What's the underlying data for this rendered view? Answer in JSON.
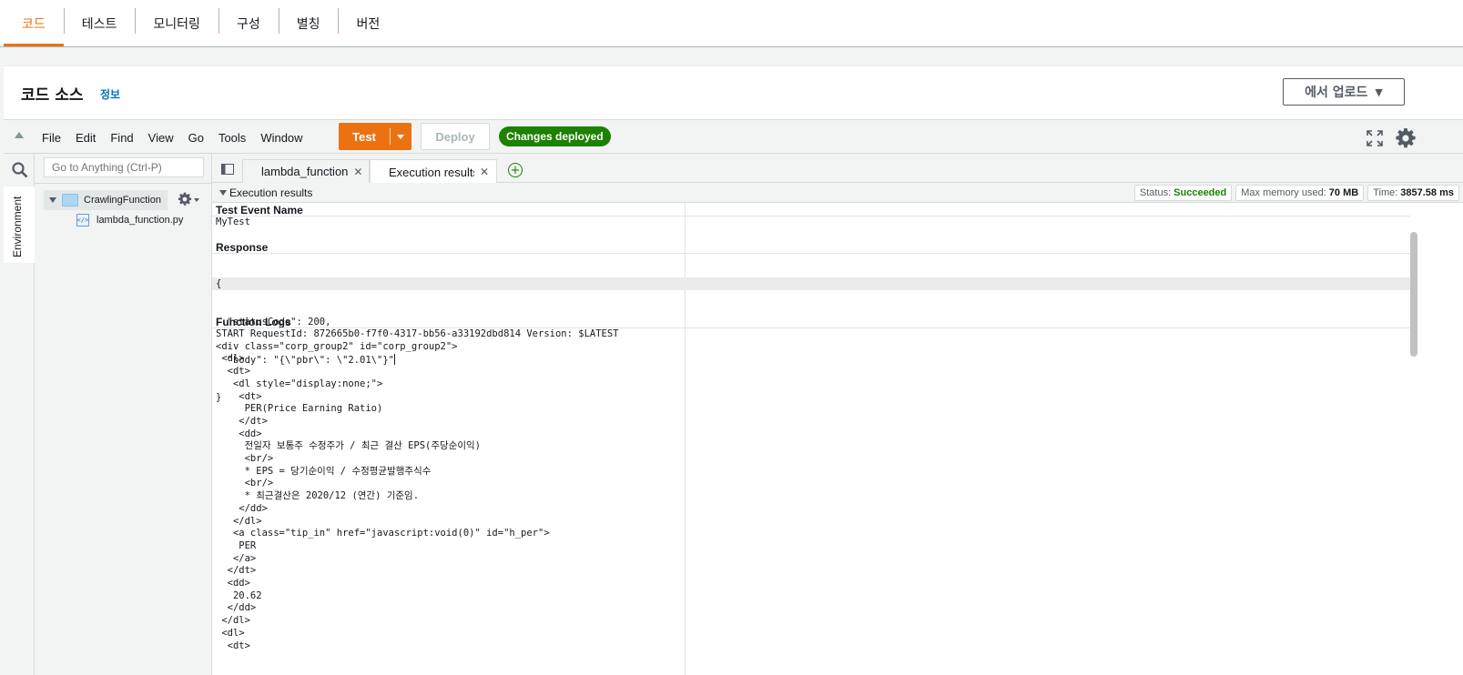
{
  "top_tabs": [
    "코드",
    "테스트",
    "모니터링",
    "구성",
    "별칭",
    "버전"
  ],
  "panel": {
    "title": "코드 소스",
    "info_link": "정보",
    "upload_button": "에서 업로드"
  },
  "toolbar": {
    "menu": [
      "File",
      "Edit",
      "Find",
      "View",
      "Go",
      "Tools",
      "Window"
    ],
    "test_label": "Test",
    "deploy_label": "Deploy",
    "status_badge": "Changes deployed"
  },
  "file_tree": {
    "search_placeholder": "Go to Anything (Ctrl-P)",
    "environment_tab": "Environment",
    "folder": "CrawlingFunction",
    "file": "lambda_function.py"
  },
  "editor_tabs": [
    {
      "label": "lambda_function"
    },
    {
      "label": "Execution results"
    }
  ],
  "results": {
    "title": "Execution results",
    "status_label": "Status:",
    "status_value": "Succeeded",
    "memory_label": "Max memory used:",
    "memory_value": "70 MB",
    "time_label": "Time:",
    "time_value": "3857.58 ms",
    "test_event_title": "Test Event Name",
    "test_event_value": "MyTest",
    "response_title": "Response",
    "response_lines": [
      "{",
      "  \"statusCode\": 200,",
      "  \"body\": \"{\\\"pbr\\\": \\\"2.01\\\"}\"",
      "}"
    ],
    "logs_title": "Function Logs",
    "log_lines": [
      "START RequestId: 872665b0-f7f0-4317-bb56-a33192dbd814 Version: $LATEST",
      "<div class=\"corp_group2\" id=\"corp_group2\">",
      " <dl>",
      "  <dt>",
      "   <dl style=\"display:none;\">",
      "    <dt>",
      "     PER(Price Earning Ratio)",
      "    </dt>",
      "    <dd>",
      "     전일자 보통주 수정주가 / 최근 결산 EPS(주당순이익)",
      "     <br/>",
      "     * EPS = 당기순이익 / 수정평균발행주식수",
      "     <br/>",
      "     * 최근결산은 2020/12 (연간) 기준임.",
      "    </dd>",
      "   </dl>",
      "   <a class=\"tip_in\" href=\"javascript:void(0)\" id=\"h_per\">",
      "    PER",
      "   </a>",
      "  </dt>",
      "  <dd>",
      "   20.62",
      "  </dd>",
      " </dl>",
      " <dl>",
      "  <dt>"
    ]
  }
}
